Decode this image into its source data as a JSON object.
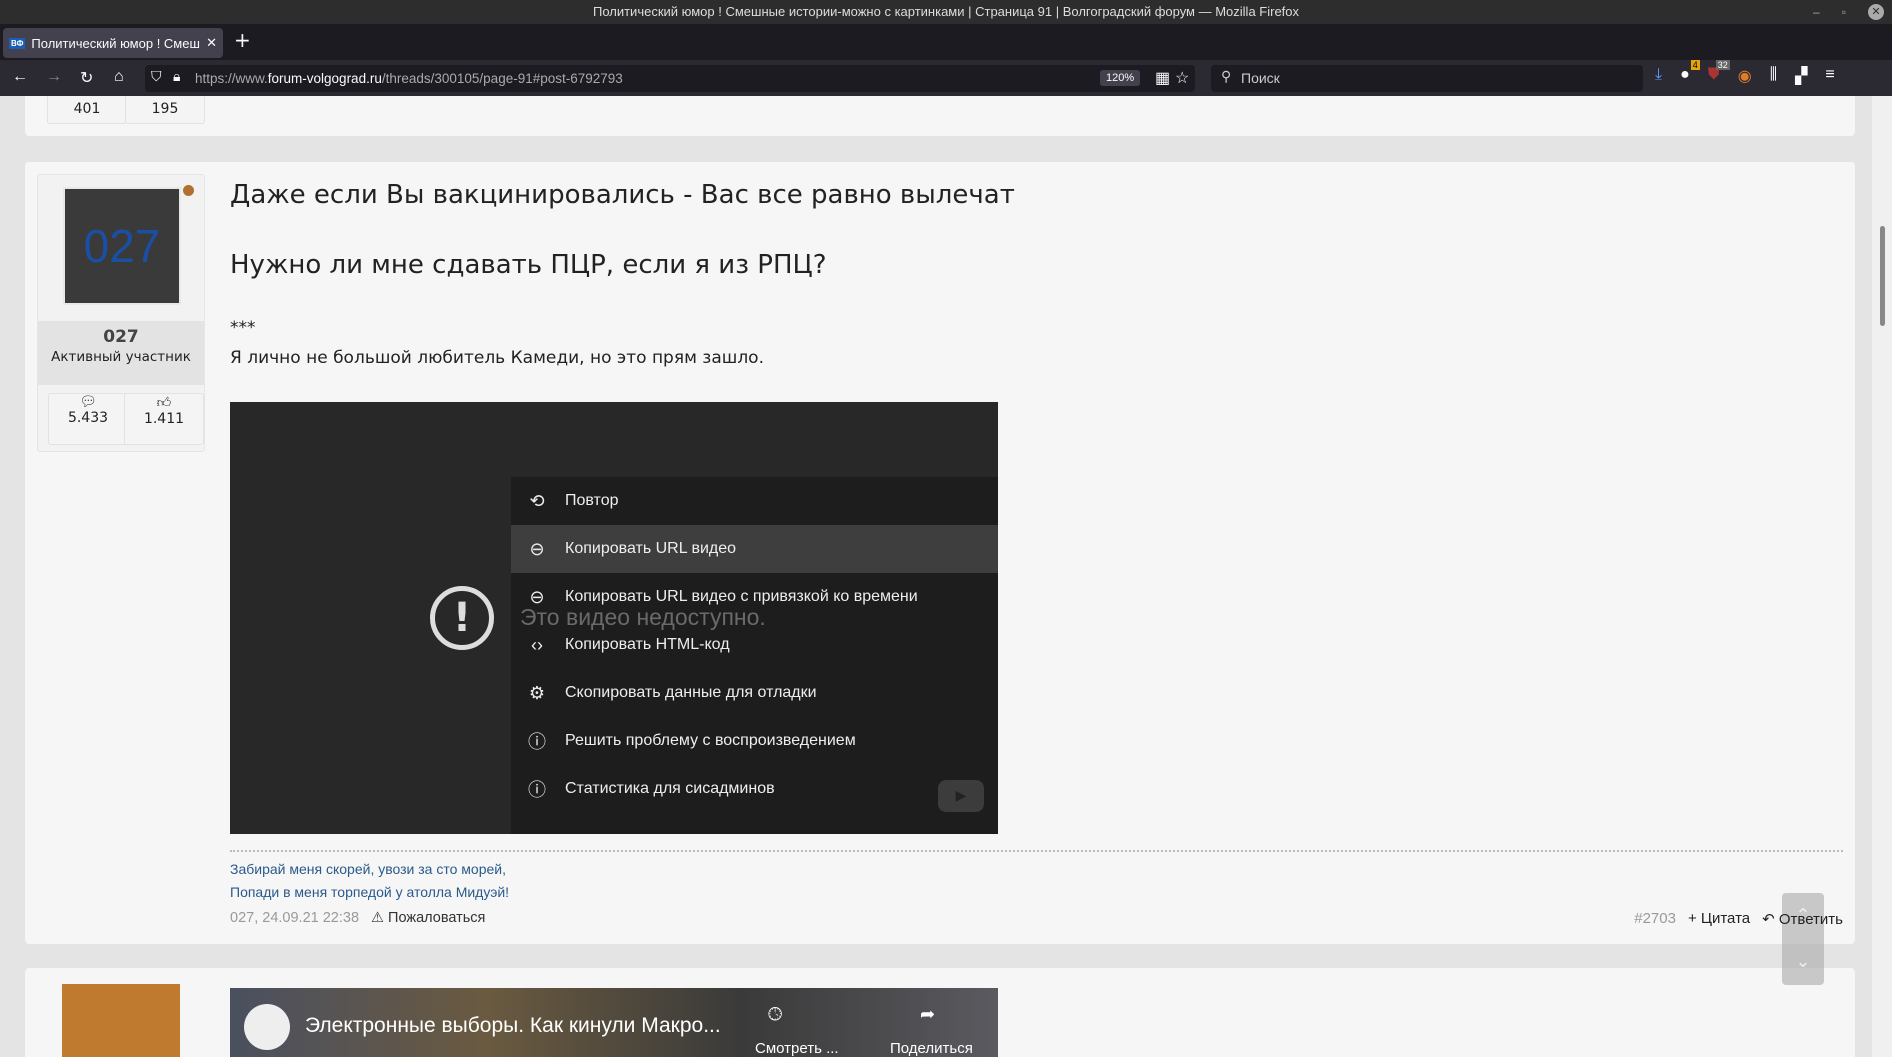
{
  "window": {
    "title": "Политический юмор ! Смешные истории-можно с картинками | Страница 91 | Волгоградский форум — Mozilla Firefox"
  },
  "tab": {
    "favicon": "ВФ",
    "label": "Политический юмор ! Смешные истории-можно с картинками"
  },
  "nav": {
    "url_prefix": "https://www.",
    "url_domain": "forum-volgograd.ru",
    "url_path": "/threads/300105/page-91#post-6792793",
    "zoom": "120%",
    "search_placeholder": "Поиск",
    "badge1": "4",
    "badge2": "32"
  },
  "prev_post": {
    "stat1": "401",
    "stat2": "195"
  },
  "post": {
    "avatar_text": "027",
    "username": "027",
    "rank": "Активный участник",
    "messages": "5.433",
    "likes": "1.411",
    "heading1": "Даже если Вы вакцинировались - Вас все равно вылечат",
    "heading2": "Нужно ли мне сдавать ПЦР, если я из РПЦ?",
    "stars": "***",
    "text": "Я лично не большой любитель Камеди, но это прям зашло.",
    "video": {
      "unavailable": "Это видео недоступно.",
      "menu": [
        {
          "icon": "repeat-icon",
          "label": "Повтор"
        },
        {
          "icon": "link-icon",
          "label": "Копировать URL видео"
        },
        {
          "icon": "link-icon",
          "label": "Копировать URL видео с привязкой ко времени"
        },
        {
          "icon": "code-icon",
          "label": "Копировать HTML-код"
        },
        {
          "icon": "bug-icon",
          "label": "Скопировать данные для отладки"
        },
        {
          "icon": "help-icon",
          "label": "Решить проблему с воспроизведением"
        },
        {
          "icon": "info-icon",
          "label": "Статистика для сисадминов"
        }
      ]
    },
    "signature": [
      "Забирай меня скорей, увози за сто морей,",
      "Попади в меня торпедой у атолла Мидуэй!"
    ],
    "meta": "027, 24.09.21 22:38",
    "report": "Пожаловаться",
    "number": "#2703",
    "quote": "+ Цитата",
    "reply": "Ответить"
  },
  "next_post": {
    "video_title": "Электронные выборы. Как кинули Макро...",
    "watch": "Смотреть ...",
    "share": "Поделиться"
  }
}
